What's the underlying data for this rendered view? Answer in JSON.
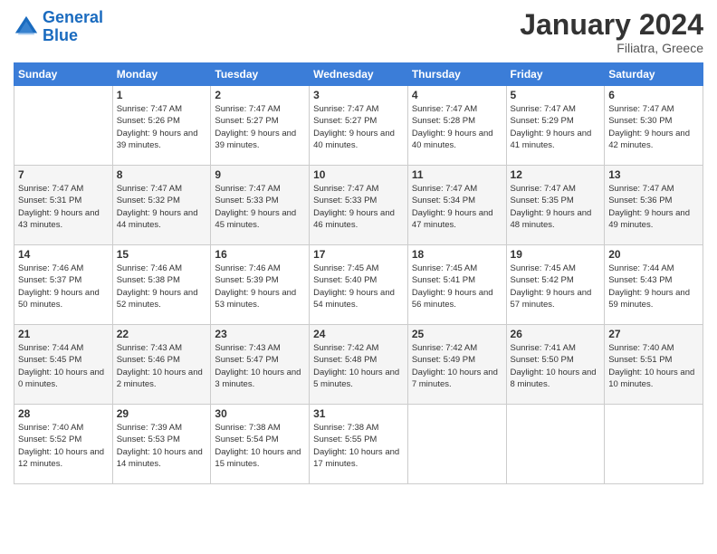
{
  "logo": {
    "line1": "General",
    "line2": "Blue"
  },
  "title": "January 2024",
  "subtitle": "Filiatra, Greece",
  "header_days": [
    "Sunday",
    "Monday",
    "Tuesday",
    "Wednesday",
    "Thursday",
    "Friday",
    "Saturday"
  ],
  "weeks": [
    [
      {
        "day": "",
        "sunrise": "",
        "sunset": "",
        "daylight": ""
      },
      {
        "day": "1",
        "sunrise": "Sunrise: 7:47 AM",
        "sunset": "Sunset: 5:26 PM",
        "daylight": "Daylight: 9 hours and 39 minutes."
      },
      {
        "day": "2",
        "sunrise": "Sunrise: 7:47 AM",
        "sunset": "Sunset: 5:27 PM",
        "daylight": "Daylight: 9 hours and 39 minutes."
      },
      {
        "day": "3",
        "sunrise": "Sunrise: 7:47 AM",
        "sunset": "Sunset: 5:27 PM",
        "daylight": "Daylight: 9 hours and 40 minutes."
      },
      {
        "day": "4",
        "sunrise": "Sunrise: 7:47 AM",
        "sunset": "Sunset: 5:28 PM",
        "daylight": "Daylight: 9 hours and 40 minutes."
      },
      {
        "day": "5",
        "sunrise": "Sunrise: 7:47 AM",
        "sunset": "Sunset: 5:29 PM",
        "daylight": "Daylight: 9 hours and 41 minutes."
      },
      {
        "day": "6",
        "sunrise": "Sunrise: 7:47 AM",
        "sunset": "Sunset: 5:30 PM",
        "daylight": "Daylight: 9 hours and 42 minutes."
      }
    ],
    [
      {
        "day": "7",
        "sunrise": "Sunrise: 7:47 AM",
        "sunset": "Sunset: 5:31 PM",
        "daylight": "Daylight: 9 hours and 43 minutes."
      },
      {
        "day": "8",
        "sunrise": "Sunrise: 7:47 AM",
        "sunset": "Sunset: 5:32 PM",
        "daylight": "Daylight: 9 hours and 44 minutes."
      },
      {
        "day": "9",
        "sunrise": "Sunrise: 7:47 AM",
        "sunset": "Sunset: 5:33 PM",
        "daylight": "Daylight: 9 hours and 45 minutes."
      },
      {
        "day": "10",
        "sunrise": "Sunrise: 7:47 AM",
        "sunset": "Sunset: 5:33 PM",
        "daylight": "Daylight: 9 hours and 46 minutes."
      },
      {
        "day": "11",
        "sunrise": "Sunrise: 7:47 AM",
        "sunset": "Sunset: 5:34 PM",
        "daylight": "Daylight: 9 hours and 47 minutes."
      },
      {
        "day": "12",
        "sunrise": "Sunrise: 7:47 AM",
        "sunset": "Sunset: 5:35 PM",
        "daylight": "Daylight: 9 hours and 48 minutes."
      },
      {
        "day": "13",
        "sunrise": "Sunrise: 7:47 AM",
        "sunset": "Sunset: 5:36 PM",
        "daylight": "Daylight: 9 hours and 49 minutes."
      }
    ],
    [
      {
        "day": "14",
        "sunrise": "Sunrise: 7:46 AM",
        "sunset": "Sunset: 5:37 PM",
        "daylight": "Daylight: 9 hours and 50 minutes."
      },
      {
        "day": "15",
        "sunrise": "Sunrise: 7:46 AM",
        "sunset": "Sunset: 5:38 PM",
        "daylight": "Daylight: 9 hours and 52 minutes."
      },
      {
        "day": "16",
        "sunrise": "Sunrise: 7:46 AM",
        "sunset": "Sunset: 5:39 PM",
        "daylight": "Daylight: 9 hours and 53 minutes."
      },
      {
        "day": "17",
        "sunrise": "Sunrise: 7:45 AM",
        "sunset": "Sunset: 5:40 PM",
        "daylight": "Daylight: 9 hours and 54 minutes."
      },
      {
        "day": "18",
        "sunrise": "Sunrise: 7:45 AM",
        "sunset": "Sunset: 5:41 PM",
        "daylight": "Daylight: 9 hours and 56 minutes."
      },
      {
        "day": "19",
        "sunrise": "Sunrise: 7:45 AM",
        "sunset": "Sunset: 5:42 PM",
        "daylight": "Daylight: 9 hours and 57 minutes."
      },
      {
        "day": "20",
        "sunrise": "Sunrise: 7:44 AM",
        "sunset": "Sunset: 5:43 PM",
        "daylight": "Daylight: 9 hours and 59 minutes."
      }
    ],
    [
      {
        "day": "21",
        "sunrise": "Sunrise: 7:44 AM",
        "sunset": "Sunset: 5:45 PM",
        "daylight": "Daylight: 10 hours and 0 minutes."
      },
      {
        "day": "22",
        "sunrise": "Sunrise: 7:43 AM",
        "sunset": "Sunset: 5:46 PM",
        "daylight": "Daylight: 10 hours and 2 minutes."
      },
      {
        "day": "23",
        "sunrise": "Sunrise: 7:43 AM",
        "sunset": "Sunset: 5:47 PM",
        "daylight": "Daylight: 10 hours and 3 minutes."
      },
      {
        "day": "24",
        "sunrise": "Sunrise: 7:42 AM",
        "sunset": "Sunset: 5:48 PM",
        "daylight": "Daylight: 10 hours and 5 minutes."
      },
      {
        "day": "25",
        "sunrise": "Sunrise: 7:42 AM",
        "sunset": "Sunset: 5:49 PM",
        "daylight": "Daylight: 10 hours and 7 minutes."
      },
      {
        "day": "26",
        "sunrise": "Sunrise: 7:41 AM",
        "sunset": "Sunset: 5:50 PM",
        "daylight": "Daylight: 10 hours and 8 minutes."
      },
      {
        "day": "27",
        "sunrise": "Sunrise: 7:40 AM",
        "sunset": "Sunset: 5:51 PM",
        "daylight": "Daylight: 10 hours and 10 minutes."
      }
    ],
    [
      {
        "day": "28",
        "sunrise": "Sunrise: 7:40 AM",
        "sunset": "Sunset: 5:52 PM",
        "daylight": "Daylight: 10 hours and 12 minutes."
      },
      {
        "day": "29",
        "sunrise": "Sunrise: 7:39 AM",
        "sunset": "Sunset: 5:53 PM",
        "daylight": "Daylight: 10 hours and 14 minutes."
      },
      {
        "day": "30",
        "sunrise": "Sunrise: 7:38 AM",
        "sunset": "Sunset: 5:54 PM",
        "daylight": "Daylight: 10 hours and 15 minutes."
      },
      {
        "day": "31",
        "sunrise": "Sunrise: 7:38 AM",
        "sunset": "Sunset: 5:55 PM",
        "daylight": "Daylight: 10 hours and 17 minutes."
      },
      {
        "day": "",
        "sunrise": "",
        "sunset": "",
        "daylight": ""
      },
      {
        "day": "",
        "sunrise": "",
        "sunset": "",
        "daylight": ""
      },
      {
        "day": "",
        "sunrise": "",
        "sunset": "",
        "daylight": ""
      }
    ]
  ]
}
